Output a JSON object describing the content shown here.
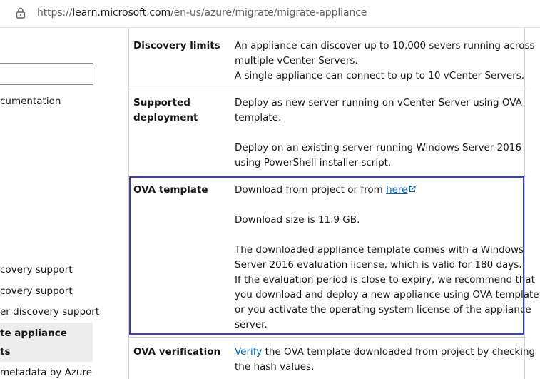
{
  "browser": {
    "url_prefix": "https://",
    "url_domain": "learn.microsoft.com",
    "url_path": "/en-us/azure/migrate/migrate-appliance"
  },
  "sidebar": {
    "items": [
      {
        "label": "cumentation"
      },
      {
        "label": "covery support"
      },
      {
        "label": "covery support"
      },
      {
        "label": "er discovery support"
      },
      {
        "label": "te appliance",
        "selected": true
      },
      {
        "label": "ts",
        "selected": true
      },
      {
        "label": "metadata by Azure"
      }
    ]
  },
  "table": {
    "rows": [
      {
        "label": [
          "Discovery limits"
        ],
        "lines": [
          "An appliance can discover up to 10,000 severs running across",
          "multiple vCenter Servers.",
          "A single appliance can connect to up to 10 vCenter Servers."
        ]
      },
      {
        "label": [
          "Supported",
          "deployment"
        ],
        "lines": [
          "Deploy as new server running on vCenter Server using OVA",
          "template.",
          "",
          "Deploy on an existing server running Windows Server 2016",
          "using PowerShell installer script."
        ]
      },
      {
        "label": [
          "OVA template"
        ],
        "link_prefix": "Download from project or from ",
        "link_text": "here",
        "lines": [
          "",
          "Download size is 11.9 GB.",
          "",
          "The downloaded appliance template comes with a Windows",
          "Server 2016 evaluation license, which is valid for 180 days.",
          "If the evaluation period is close to expiry, we recommend that",
          "you download and deploy a new appliance using OVA template,",
          "or you activate the operating system license of the appliance",
          "server."
        ]
      },
      {
        "label": [
          "OVA verification"
        ],
        "link_text": "Verify",
        "first_line_rest": " the OVA template downloaded from project by checking",
        "lines": [
          "the hash values."
        ]
      }
    ]
  },
  "colors": {
    "highlight_border": "#4040b8",
    "link": "#0065b3"
  }
}
